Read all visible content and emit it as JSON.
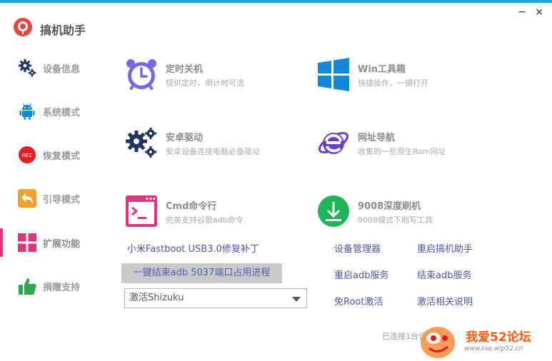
{
  "app": {
    "title": "搞机助手"
  },
  "window": {
    "minimize_glyph": "−",
    "close_glyph": "×"
  },
  "sidebar": {
    "items": [
      {
        "label": "设备信息",
        "icon": "gears-icon"
      },
      {
        "label": "系统模式",
        "icon": "android-icon"
      },
      {
        "label": "恢复模式",
        "icon": "rec-icon",
        "badge": "REC"
      },
      {
        "label": "引导模式",
        "icon": "back-arrow-icon"
      },
      {
        "label": "扩展功能",
        "icon": "grid-icon",
        "active": true
      },
      {
        "label": "捐赠支持",
        "icon": "thumbs-up-icon"
      }
    ]
  },
  "tools": [
    {
      "name": "定时关机",
      "desc": "提供定时，倒计时可选",
      "icon": "alarm-clock-icon",
      "color": "#7a64e6"
    },
    {
      "name": "Win工具箱",
      "desc": "快捷操作，一键打开",
      "icon": "windows-icon",
      "color": "#1289d8"
    },
    {
      "name": "安卓驱动",
      "desc": "安卓设备连接电脑必备驱动",
      "icon": "gears-icon",
      "color": "#1f3560"
    },
    {
      "name": "网址导航",
      "desc": "收集的一些原生Rom网址",
      "icon": "ie-icon",
      "color": "#6a3fc8"
    },
    {
      "name": "Cmd命令行",
      "desc": "完美支持谷歌adb命令",
      "icon": "terminal-icon",
      "color": "#e0357a"
    },
    {
      "name": "9008深度刷机",
      "desc": "9008模式下刷写工具",
      "icon": "download-icon",
      "color": "#1fb35a"
    }
  ],
  "links": {
    "fastboot_patch": "小米Fastboot USB3.0修复补丁",
    "kill_adb": "一键结束adb 5037端口占用进程",
    "device_manager": "设备管理器",
    "restart_app": "重启搞机助手",
    "restart_adb": "重启adb服务",
    "stop_adb": "结束adb服务",
    "root_free": "免Root激活",
    "activate_help": "激活相关说明"
  },
  "dropdown": {
    "selected": "激活Shizuku"
  },
  "status": {
    "text": "已连接1台设备(2"
  },
  "watermark": {
    "title": "我爱52论坛",
    "url": "www.tao.wip52.cn"
  },
  "colors": {
    "accent": "#1aa1e6",
    "active_indicator": "#e0357a",
    "link": "#4a55a8"
  }
}
